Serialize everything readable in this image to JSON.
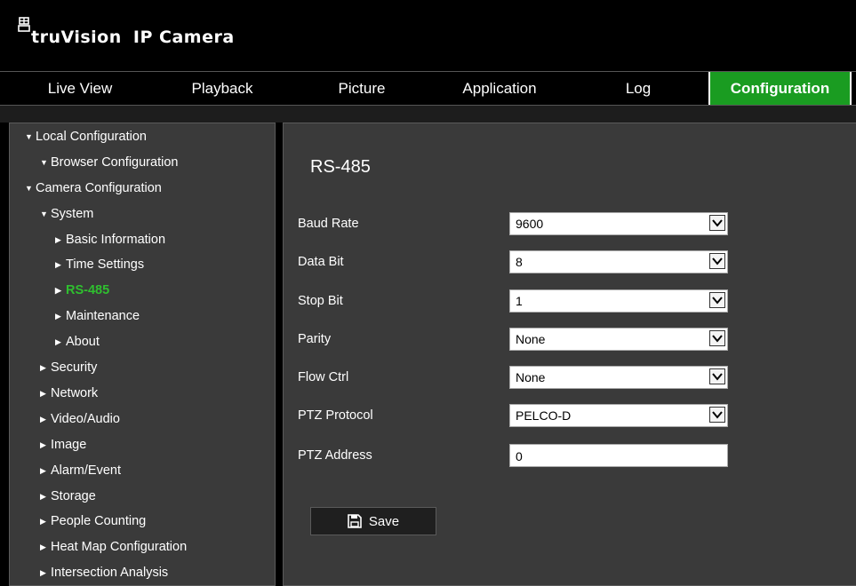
{
  "header": {
    "brand_prefix": "truVision",
    "brand_suffix": "IP Camera"
  },
  "nav": {
    "tabs": [
      {
        "label": "Live View"
      },
      {
        "label": "Playback"
      },
      {
        "label": "Picture"
      },
      {
        "label": "Application"
      },
      {
        "label": "Log"
      },
      {
        "label": "Configuration",
        "active": true
      }
    ]
  },
  "sidebar": {
    "items": [
      {
        "label": "Local Configuration",
        "expanded": true
      },
      {
        "label": "Browser Configuration",
        "expanded": true
      },
      {
        "label": "Camera Configuration",
        "expanded": true
      },
      {
        "label": "System",
        "expanded": true
      },
      {
        "label": "Basic Information"
      },
      {
        "label": "Time Settings"
      },
      {
        "label": "RS-485",
        "active": true
      },
      {
        "label": "Maintenance"
      },
      {
        "label": "About"
      },
      {
        "label": "Security"
      },
      {
        "label": "Network"
      },
      {
        "label": "Video/Audio"
      },
      {
        "label": "Image"
      },
      {
        "label": "Alarm/Event"
      },
      {
        "label": "Storage"
      },
      {
        "label": "People Counting"
      },
      {
        "label": "Heat Map Configuration"
      },
      {
        "label": "Intersection Analysis"
      }
    ]
  },
  "main": {
    "title": "RS-485",
    "fields": [
      {
        "label": "Baud Rate",
        "value": "9600",
        "type": "select"
      },
      {
        "label": "Data Bit",
        "value": "8",
        "type": "select"
      },
      {
        "label": "Stop Bit",
        "value": "1",
        "type": "select"
      },
      {
        "label": "Parity",
        "value": "None",
        "type": "select"
      },
      {
        "label": "Flow Ctrl",
        "value": "None",
        "type": "select"
      },
      {
        "label": "PTZ Protocol",
        "value": "PELCO-D",
        "type": "select"
      },
      {
        "label": "PTZ Address",
        "value": "0",
        "type": "text"
      }
    ],
    "save_label": "Save"
  },
  "colors": {
    "accent": "#1a9c21",
    "active_text": "#2fbf2f",
    "panel_bg": "#3a3a3a"
  },
  "icons": {
    "brand": "camera-logo-icon",
    "save": "floppy-disk-icon",
    "expanded": "triangle-down-icon",
    "collapsed": "triangle-right-icon",
    "dropdown": "chevron-down-icon"
  }
}
